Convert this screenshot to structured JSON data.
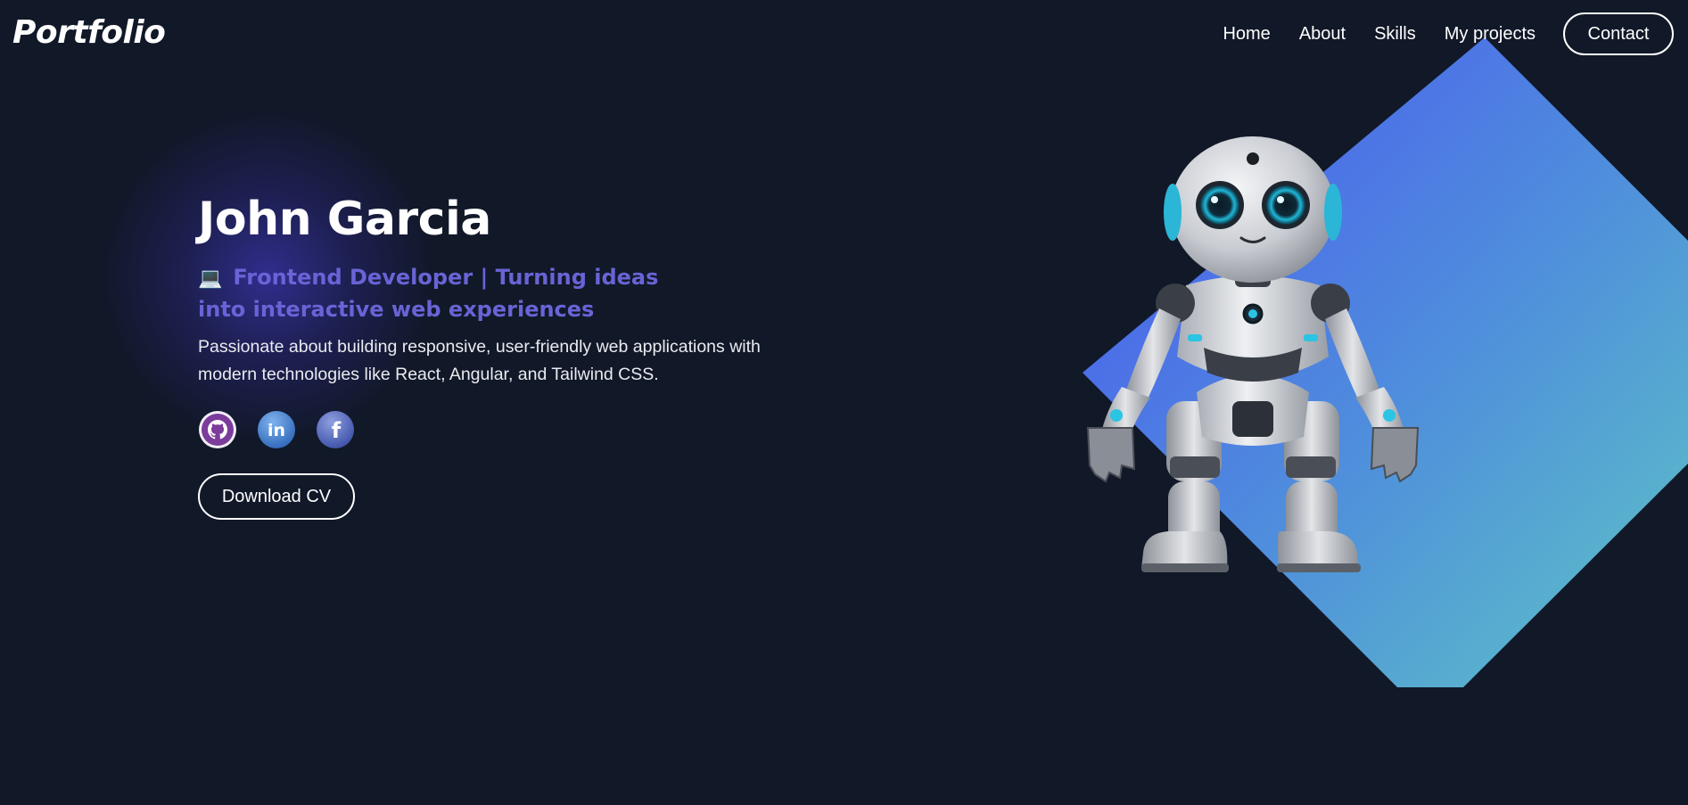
{
  "nav": {
    "logo": "Portfolio",
    "links": [
      "Home",
      "About",
      "Skills",
      "My projects"
    ],
    "contact_label": "Contact"
  },
  "hero": {
    "name": "John Garcia",
    "tagline_icon": "💻",
    "tagline": "Frontend Developer | Turning ideas into interactive web experiences",
    "description": "Passionate about building responsive, user-friendly web applications with modern technologies like React, Angular, and Tailwind CSS.",
    "socials": [
      {
        "icon": "github-icon",
        "color": "#7b3c9c"
      },
      {
        "icon": "linkedin-icon",
        "color": "#3f7fd0"
      },
      {
        "icon": "facebook-icon",
        "color": "#4d63b5"
      }
    ],
    "download_label": "Download CV"
  },
  "colors": {
    "background": "#111828",
    "accent": "#6a63d6",
    "diamond_start": "#4a5cf0",
    "diamond_end": "#5ec0c8"
  }
}
